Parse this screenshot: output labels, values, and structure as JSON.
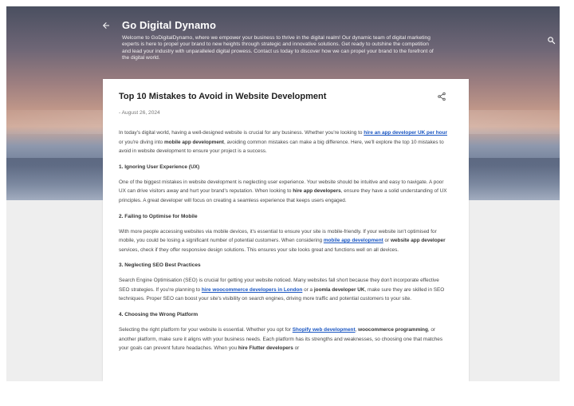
{
  "header": {
    "title": "Go Digital Dynamo",
    "description": "Welcome to GoDigitalDynamo, where we empower your business to thrive in the digital realm! Our dynamic team of digital marketing experts is here to propel your brand to new heights through strategic and innovative solutions. Get ready to outshine the competition and lead your industry with unparalleled digital prowess. Contact us today to discover how we can propel your brand to the forefront of the digital world.",
    "back_icon": "arrow-back-icon",
    "search_icon": "search-icon"
  },
  "post": {
    "title": "Top 10 Mistakes to Avoid in Website Development",
    "date": "- August 26, 2024",
    "share_icon": "share-icon",
    "intro": {
      "t1": "In today's digital world, having a well-designed website is crucial for any business. Whether you're looking to ",
      "link1": "hire an app developer UK per hour",
      "t2": " or you're diving into ",
      "bold1": "mobile app development",
      "t3": ", avoiding common mistakes can make a big difference. Here, we'll explore the top 10 mistakes to avoid in website development to ensure your project is a success."
    },
    "s1": {
      "heading": "1. Ignoring User Experience (UX)",
      "t1": "One of the biggest mistakes in website development is neglecting user experience. Your website should be intuitive and easy to navigate. A poor UX can drive visitors away and hurt your brand's reputation. When looking to ",
      "bold1": "hire app developers",
      "t2": ", ensure they have a solid understanding of UX principles. A great developer will focus on creating a seamless experience that keeps users engaged."
    },
    "s2": {
      "heading": "2. Failing to Optimise for Mobile",
      "t1": "With more people accessing websites via mobile devices, it's essential to ensure your site is mobile-friendly. If your website isn't optimised for mobile, you could be losing a significant number of potential customers. When considering ",
      "link1": "mobile app development",
      "t2": " or ",
      "bold1": "website app developer",
      "t3": " services, check if they offer responsive design solutions. This ensures your site looks great and functions well on all devices."
    },
    "s3": {
      "heading": "3. Neglecting SEO Best Practices",
      "t1": "Search Engine Optimisation (SEO) is crucial for getting your website noticed. Many websites fall short because they don't incorporate effective SEO strategies. If you're planning to ",
      "link1": "hire woocommerce developers in London",
      "t2": " or a ",
      "bold1": "joomla developer UK",
      "t3": ", make sure they are skilled in SEO techniques. Proper SEO can boost your site's visibility on search engines, driving more traffic and potential customers to your site."
    },
    "s4": {
      "heading": "4. Choosing the Wrong Platform",
      "t1": "Selecting the right platform for your website is essential. Whether you opt for ",
      "link1": "Shopify web development",
      "t2": ", ",
      "bold1": "woocommerce programming",
      "t3": ", or another platform, make sure it aligns with your business needs. Each platform has its strengths and weaknesses, so choosing one that matches your goals can prevent future headaches. When you ",
      "bold2": "hire Flutter developers",
      "t4": " or"
    }
  }
}
